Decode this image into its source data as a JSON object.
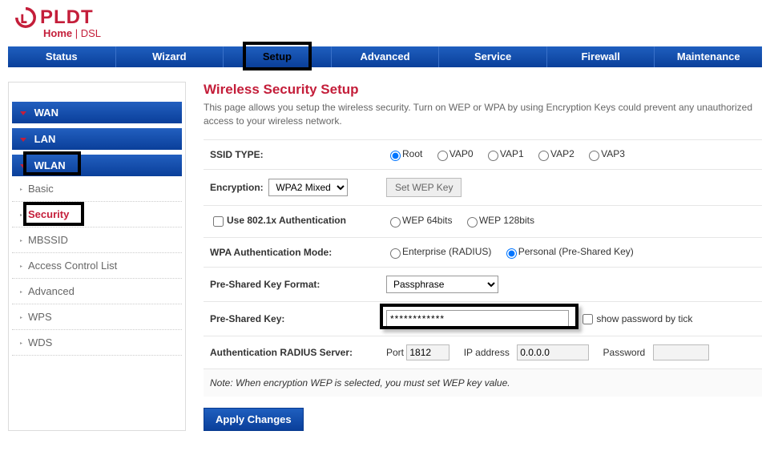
{
  "brand": {
    "name": "PLDT",
    "sub1": "Home",
    "sub2": " | DSL"
  },
  "nav": {
    "items": [
      "Status",
      "Wizard",
      "Setup",
      "Advanced",
      "Service",
      "Firewall",
      "Maintenance"
    ],
    "active": "Setup"
  },
  "sidebar": {
    "sections": [
      "WAN",
      "LAN",
      "WLAN"
    ],
    "wlan_items": [
      "Basic",
      "Security",
      "MBSSID",
      "Access Control List",
      "Advanced",
      "WPS",
      "WDS"
    ],
    "active": "Security"
  },
  "page": {
    "title": "Wireless Security Setup",
    "desc": "This page allows you setup the wireless security. Turn on WEP or WPA by using Encryption Keys could prevent any unauthorized access to your wireless network."
  },
  "form": {
    "ssid_type_label": "SSID TYPE:",
    "ssid_options": [
      "Root",
      "VAP0",
      "VAP1",
      "VAP2",
      "VAP3"
    ],
    "ssid_selected": "Root",
    "encryption_label": "Encryption:",
    "encryption_value": "WPA2 Mixed",
    "set_wep_btn": "Set WEP Key",
    "use8021x_label": "Use 802.1x Authentication",
    "wep_options": [
      "WEP 64bits",
      "WEP 128bits"
    ],
    "wpa_mode_label": "WPA Authentication Mode:",
    "wpa_mode_options": [
      "Enterprise (RADIUS)",
      "Personal (Pre-Shared Key)"
    ],
    "wpa_mode_selected": "Personal (Pre-Shared Key)",
    "psk_format_label": "Pre-Shared Key Format:",
    "psk_format_value": "Passphrase",
    "psk_label": "Pre-Shared Key:",
    "psk_value": "************",
    "show_pw_label": "show password by tick",
    "radius_label": "Authentication RADIUS Server:",
    "radius_port_label": "Port",
    "radius_port": "1812",
    "radius_ip_label": "IP address",
    "radius_ip": "0.0.0.0",
    "radius_pw_label": "Password",
    "radius_pw": "",
    "note": "Note: When encryption WEP is selected, you must set WEP key value.",
    "apply": "Apply Changes"
  }
}
